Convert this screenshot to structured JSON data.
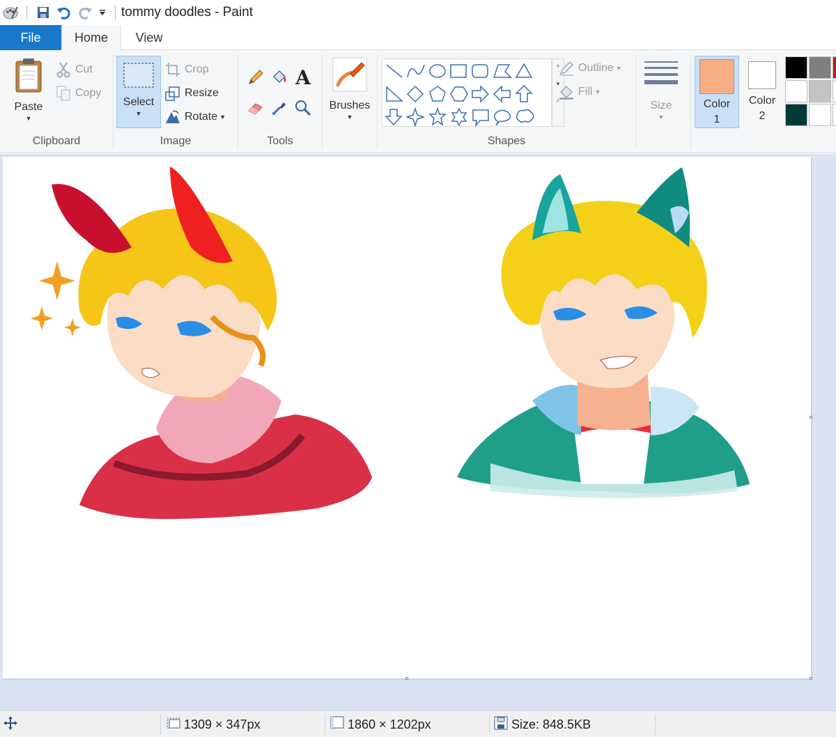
{
  "window": {
    "title": "tommy doodles - Paint"
  },
  "tabs": [
    {
      "label": "File"
    },
    {
      "label": "Home"
    },
    {
      "label": "View"
    }
  ],
  "clipboard": {
    "paste": "Paste",
    "cut": "Cut",
    "copy": "Copy",
    "label": "Clipboard"
  },
  "image": {
    "select": "Select",
    "crop": "Crop",
    "resize": "Resize",
    "rotate": "Rotate",
    "label": "Image"
  },
  "tools": {
    "label": "Tools"
  },
  "brushes": {
    "label": "Brushes"
  },
  "shapes": {
    "outline": "Outline",
    "fill": "Fill",
    "label": "Shapes"
  },
  "size": {
    "label": "Size"
  },
  "colors": {
    "color1_label": "Color\n1",
    "color2_label": "Color\n2",
    "color1_value": "#f8ad85",
    "color2_value": "#ffffff",
    "palette": [
      "#000000",
      "#7f7f7f",
      "#ffffff",
      "#c3c3c3",
      "#003a38",
      "#ffffff"
    ]
  },
  "status": {
    "selection": "1309 × 347px",
    "canvas_size": "1860 × 1202px",
    "file_size": "Size: 848.5KB"
  },
  "accent": "#1979ca",
  "workspace_bg": "#dae3f1"
}
